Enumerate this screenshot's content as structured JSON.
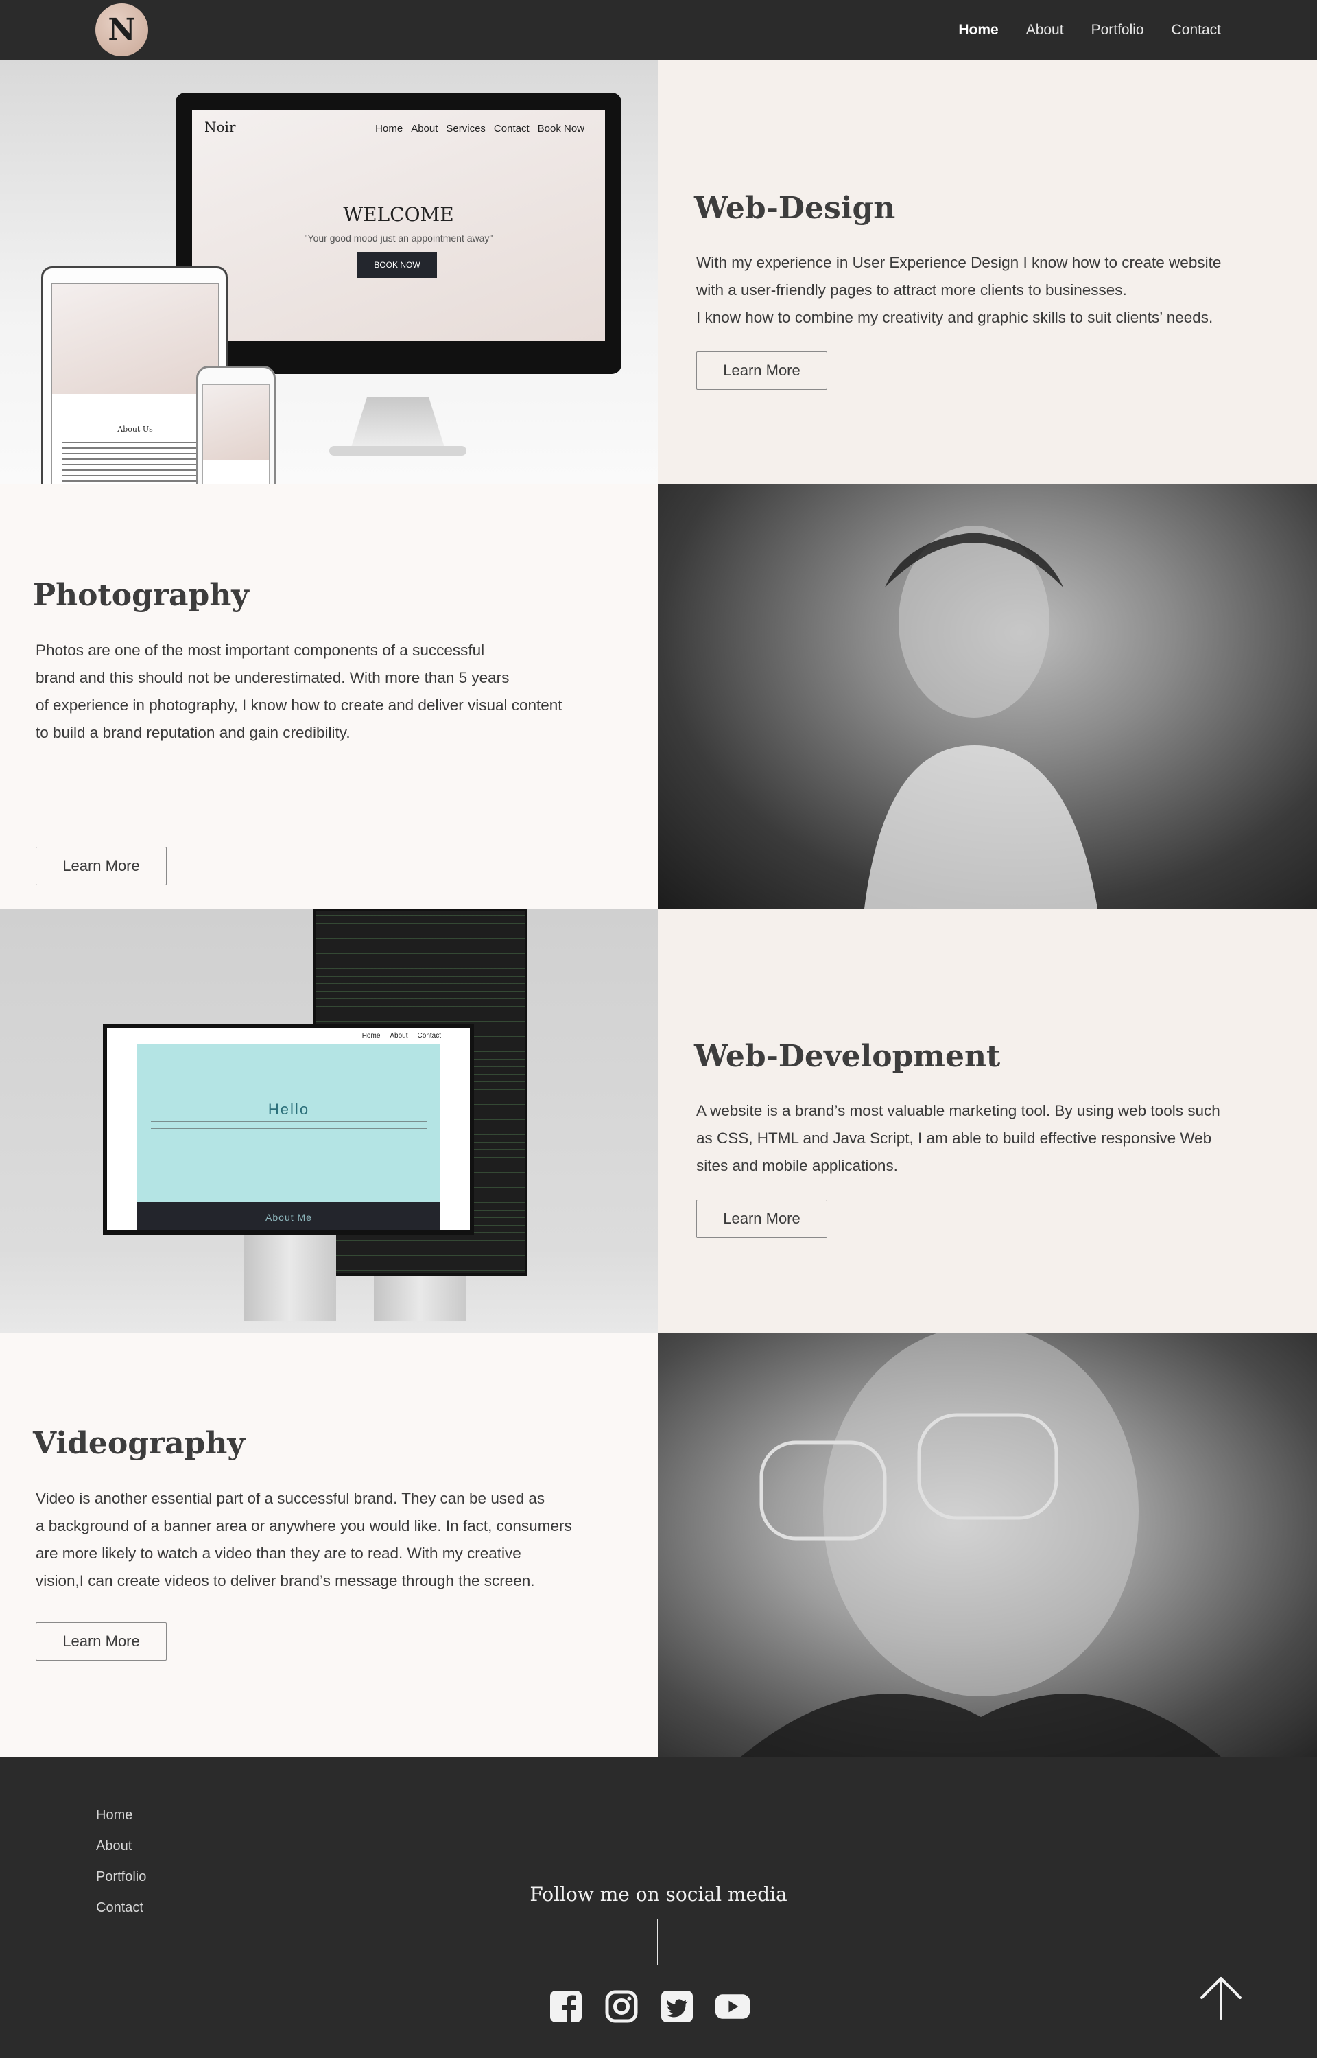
{
  "nav": {
    "logo_letter": "N",
    "links": [
      "Home",
      "About",
      "Portfolio",
      "Contact"
    ]
  },
  "sections": [
    {
      "title": "Web-Design",
      "body": "With my experience in User Experience Design I know how to create website\nwith a user-friendly pages to attract more  clients to businesses.\nI  know how to combine my creativity and graphic skills to suit  clients’ needs.",
      "button": "Learn More"
    },
    {
      "title": "Photography",
      "body": "Photos are one of the most important components of a successful\nbrand and this should not be underestimated. With more than 5 years\nof experience in photography, I know how to create and deliver  visual content\nto build a brand reputation and gain credibility.",
      "button": "Learn More"
    },
    {
      "title": "Web-Development",
      "body": "A website is a brand’s most valuable marketing tool. By using web tools such\nas CSS, HTML and Java Script, I am able to build effective responsive Web\nsites and mobile applications.",
      "button": "Learn More"
    },
    {
      "title": "Videography",
      "body": "Video is another essential part of a successful brand. They can be used as\na background of a banner area or anywhere you would like. In fact, consumers\nare more likely to watch a video than they are to read. With my creative\nvision,I can create videos to deliver brand’s message through the screen.",
      "button": "Learn More"
    }
  ],
  "mockup1": {
    "brand": "Noir",
    "nav": [
      "Home",
      "About",
      "Services",
      "Contact",
      "Book Now"
    ],
    "welcome": "WELCOME",
    "tagline": "\"Your good mood just an appointment away\"",
    "book_button": "BOOK NOW",
    "about": "About Us"
  },
  "mockup2": {
    "nav": [
      "Home",
      "About",
      "Contact"
    ],
    "hello": "Hello",
    "about": "About Me"
  },
  "footer": {
    "links": [
      "Home",
      "About",
      "Portfolio",
      "Contact"
    ],
    "follow": "Follow me on social media",
    "socials": [
      "facebook-icon",
      "instagram-icon",
      "twitter-icon",
      "youtube-icon"
    ]
  }
}
